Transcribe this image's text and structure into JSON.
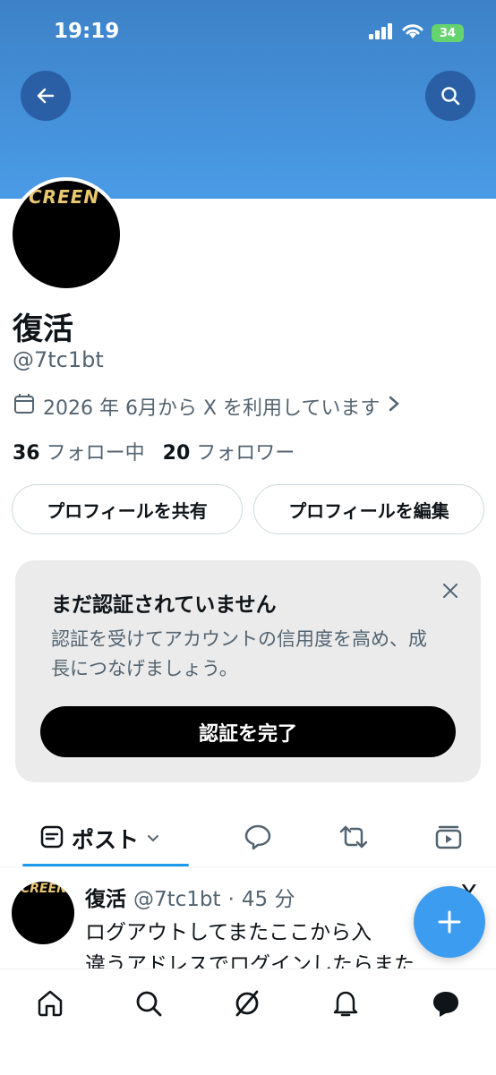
{
  "status_bar": {
    "time": "19:19",
    "battery": "34"
  },
  "profile": {
    "avatar_text": "CREEN",
    "name": "復活",
    "handle": "@7tc1bt",
    "joined": "2026 年 6月から X を利用しています",
    "following_count": "36",
    "following_label": "フォロー中",
    "followers_count": "20",
    "followers_label": "フォロワー"
  },
  "actions": {
    "share_label": "プロフィールを共有",
    "edit_label": "プロフィールを編集"
  },
  "verify_card": {
    "title": "まだ認証されていません",
    "description": "認証を受けてアカウントの信用度を高め、成長につなげましょう。",
    "button_label": "認証を完了"
  },
  "tabs": {
    "posts_label": "ポスト"
  },
  "post": {
    "avatar_text": "CREEN",
    "name": "復活",
    "handle": "@7tc1bt",
    "time": "45 分",
    "line1": "ログアウトしてまたここから入",
    "line2": "違うアドレスでログインしたらまた",
    "corner_mark": "X"
  },
  "colors": {
    "accent": "#1d9bf0",
    "banner": "#4a9be6",
    "fab": "#3b9cf0"
  }
}
